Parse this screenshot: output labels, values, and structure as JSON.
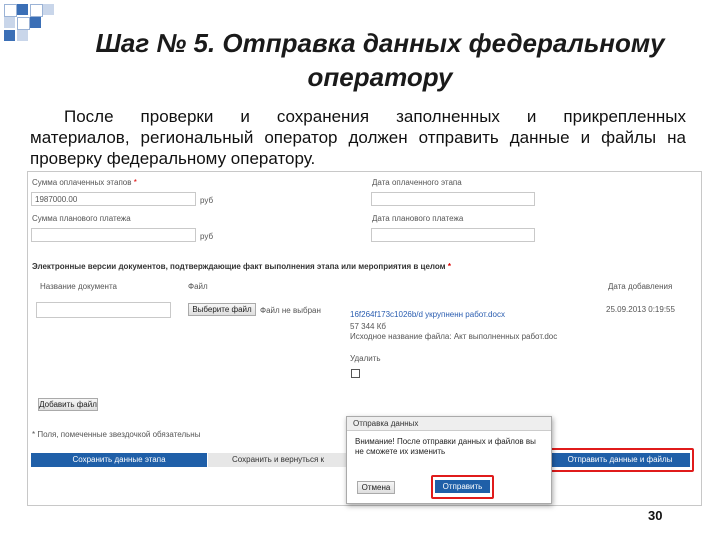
{
  "slide": {
    "title_line1": "Шаг № 5. Отправка данных федеральному",
    "title_line2": "оператору",
    "paragraph_line1": "После проверки и сохранения заполненных и прикрепленных",
    "paragraph_line2": "материалов, региональный оператор должен отправить данные и файлы на",
    "paragraph_line3": "проверку федеральному оператору.",
    "page_number": "30"
  },
  "form": {
    "sum_planned_label": "Сумма оплаченных этапов",
    "sum_planned_value": "1987000.00",
    "currency1": "руб",
    "date_planned_label": "Дата оплаченного этапа",
    "sum_planned2_label": "Сумма планового платежа",
    "currency2": "руб",
    "date_planned2_label": "Дата планового платежа",
    "docs_section_label": "Электронные версии документов, подтверждающие факт выполнения этапа или мероприятия в целом",
    "col_doc_name": "Название документа",
    "col_file": "Файл",
    "col_date_added": "Дата добавления",
    "choose_file_button": "Выберите файл",
    "no_file_selected": "Файл не выбран",
    "file_link": "16f264f173c1026b/d укрупненн работ.docx",
    "file_size": "57 344 Кб",
    "file_original_name": "Исходное название файла: Акт выполненных работ.doc",
    "date_added_value": "25.09.2013 0:19:55",
    "delete_label": "Удалить",
    "add_file_button": "Добавить файл",
    "required_note": "* Поля, помеченные звездочкой обязательны",
    "save_stage_button": "Сохранить данные этапа",
    "save_return_button": "Сохранить и вернуться к мероприятиям",
    "send_data_files_button": "Отправить данные и файлы"
  },
  "modal": {
    "title": "Отправка данных",
    "message_line1": "Внимание! После отправки данных и файлов вы",
    "message_line2": "не сможете их изменить",
    "cancel_button": "Отмена",
    "send_button": "Отправить"
  },
  "colors": {
    "accent_blue": "#1f5fa8",
    "highlight_red": "#e01b1b",
    "deco_blue": "#3b6fb6"
  }
}
